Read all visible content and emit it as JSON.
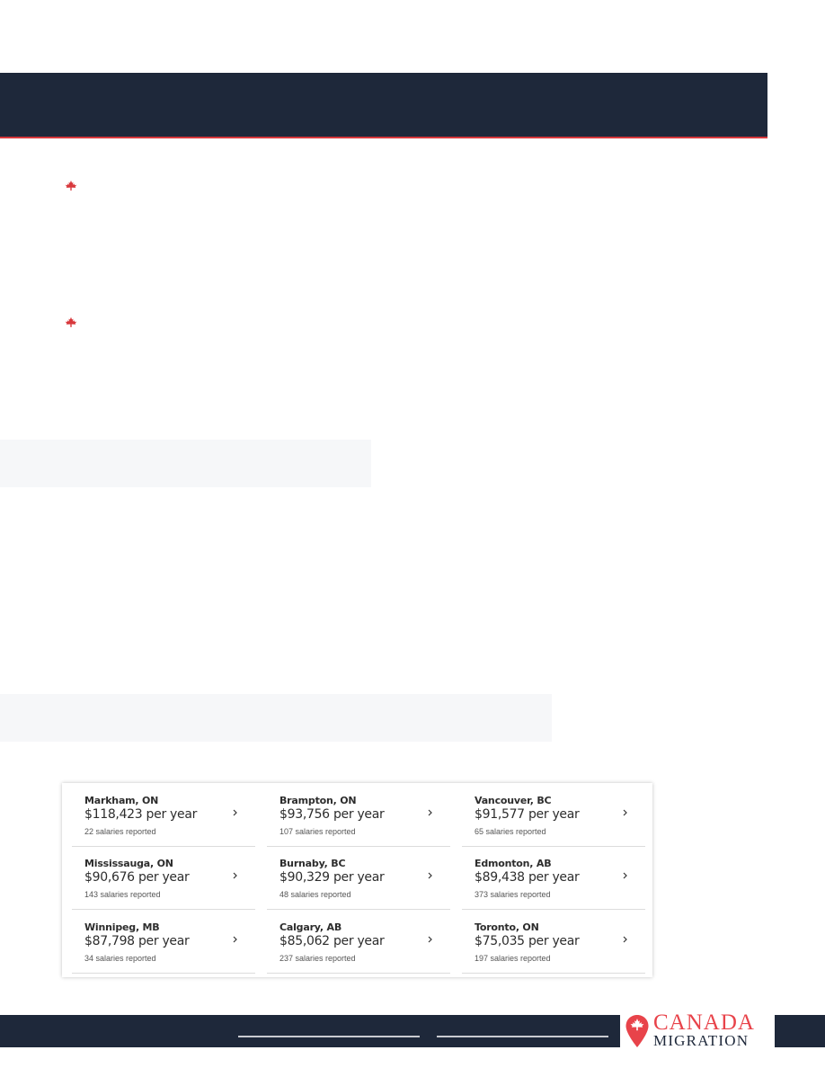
{
  "brand": {
    "name_line1": "CANADA",
    "name_line2": "MIGRATION",
    "accent_color": "#e8434a",
    "navy_color": "#1e283a"
  },
  "bullets": [
    {
      "icon": "maple-leaf-icon"
    },
    {
      "icon": "maple-leaf-icon"
    }
  ],
  "salaries": [
    {
      "city": "Markham, ON",
      "salary": "$118,423 per year",
      "count": "22 salaries reported"
    },
    {
      "city": "Brampton, ON",
      "salary": "$93,756 per year",
      "count": "107 salaries reported"
    },
    {
      "city": "Vancouver, BC",
      "salary": "$91,577 per year",
      "count": "65 salaries reported"
    },
    {
      "city": "Mississauga, ON",
      "salary": "$90,676 per year",
      "count": "143 salaries reported"
    },
    {
      "city": "Burnaby, BC",
      "salary": "$90,329 per year",
      "count": "48 salaries reported"
    },
    {
      "city": "Edmonton, AB",
      "salary": "$89,438 per year",
      "count": "373 salaries reported"
    },
    {
      "city": "Winnipeg, MB",
      "salary": "$87,798 per year",
      "count": "34 salaries reported"
    },
    {
      "city": "Calgary, AB",
      "salary": "$85,062 per year",
      "count": "237 salaries reported"
    },
    {
      "city": "Toronto, ON",
      "salary": "$75,035 per year",
      "count": "197 salaries reported"
    }
  ]
}
